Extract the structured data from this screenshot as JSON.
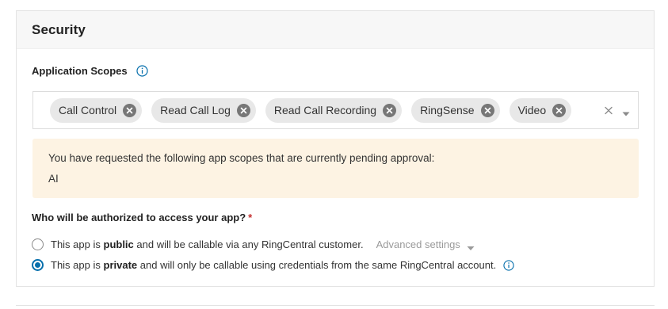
{
  "section": {
    "title": "Security"
  },
  "scopes": {
    "label": "Application Scopes",
    "info_icon": "info-icon",
    "chips": [
      {
        "label": "Call Control"
      },
      {
        "label": "Read Call Log"
      },
      {
        "label": "Read Call Recording"
      },
      {
        "label": "RingSense"
      },
      {
        "label": "Video"
      }
    ],
    "clear_icon": "close-icon",
    "dropdown_icon": "caret-down-icon"
  },
  "notice": {
    "text": "You have requested the following app scopes that are currently pending approval:",
    "pending": "AI"
  },
  "access": {
    "question": "Who will be authorized to access your app?",
    "required_mark": "*",
    "options": [
      {
        "prefix": "This app is",
        "emphasis": "public",
        "suffix": "and will be callable via any RingCentral customer.",
        "checked": false,
        "extra_link": "Advanced settings"
      },
      {
        "prefix": "This app is",
        "emphasis": "private",
        "suffix": "and will only be callable using credentials from the same RingCentral account.",
        "checked": true
      }
    ]
  },
  "colors": {
    "accent": "#066fac",
    "notice_bg": "#fdf3e3",
    "chip_bg": "#e8e8e8",
    "required": "#c53030"
  }
}
